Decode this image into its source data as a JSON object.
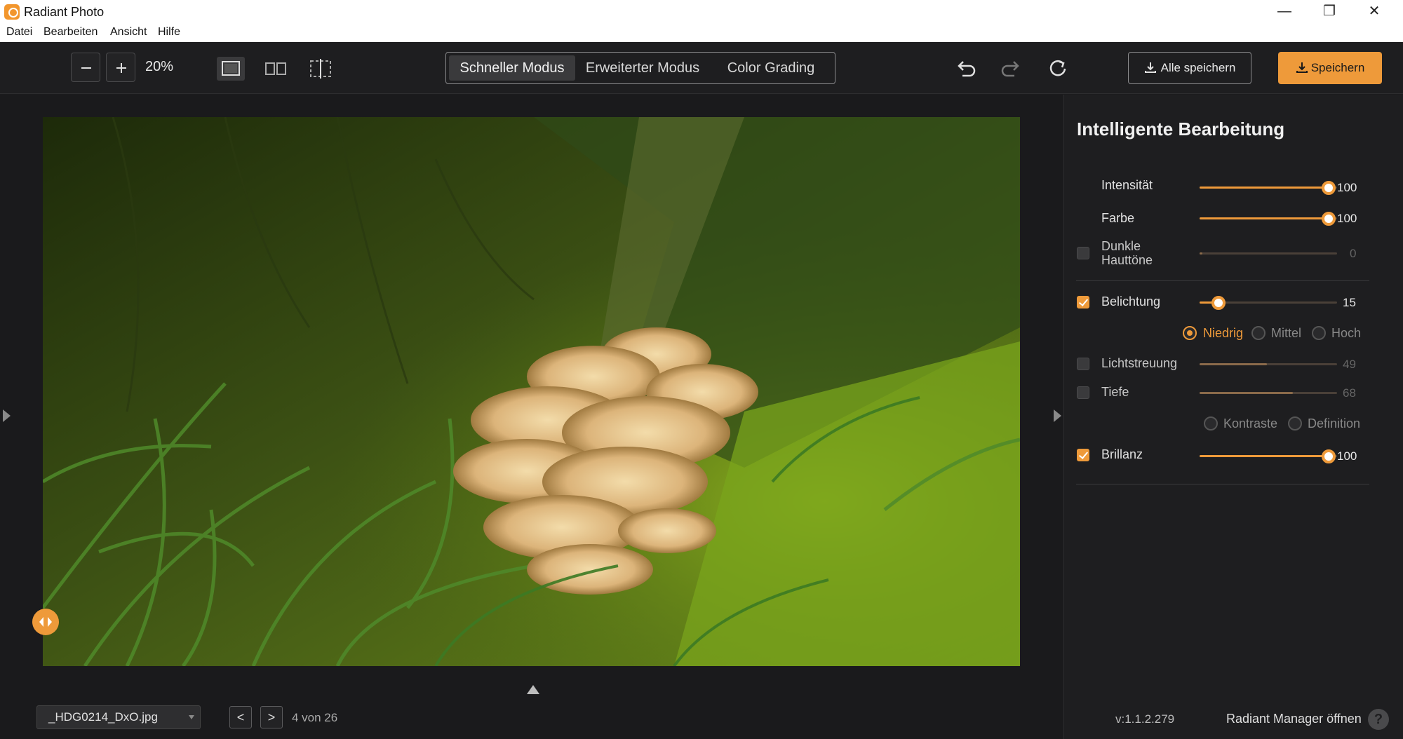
{
  "window": {
    "title": "Radiant Photo",
    "minimize_icon": "—",
    "maximize_icon": "❐",
    "close_icon": "✕"
  },
  "menu": [
    "Datei",
    "Bearbeiten",
    "Ansicht",
    "Hilfe"
  ],
  "toolbar": {
    "zoom_out_icon": "minus-icon",
    "zoom_in_icon": "plus-icon",
    "zoom_level": "20%",
    "modes": [
      "Schneller Modus",
      "Erweiterter Modus",
      "Color Grading"
    ],
    "active_mode": "Schneller Modus",
    "save_all_label": "Alle speichern",
    "save_label": "Speichern",
    "accent_color": "#ee9a3a"
  },
  "panel": {
    "title": "Intelligente Bearbeitung",
    "adjustments": [
      {
        "label": "Intensität",
        "value": "100",
        "fraction": 0.94,
        "checkbox": null
      },
      {
        "label": "Farbe",
        "value": "100",
        "fraction": 0.94,
        "checkbox": null
      },
      {
        "label": "Dunkle Hauttöne",
        "value": "0",
        "fraction": 0.0,
        "checkbox": false
      },
      {
        "label": "Belichtung",
        "value": "15",
        "fraction": 0.14,
        "checkbox": true
      },
      {
        "label": "Lichtstreuung",
        "value": "49",
        "fraction": 0.49,
        "checkbox": false
      },
      {
        "label": "Tiefe",
        "value": "68",
        "fraction": 0.68,
        "checkbox": false
      },
      {
        "label": "Brillanz",
        "value": "100",
        "fraction": 0.94,
        "checkbox": true
      }
    ],
    "exposure_options": [
      "Niedrig",
      "Mittel",
      "Hoch"
    ],
    "exposure_selected": "Niedrig",
    "depth_options": [
      "Kontraste",
      "Definition"
    ],
    "version": "v:1.1.2.279",
    "manager_link": "Radiant Manager öffnen",
    "help_icon": "?"
  },
  "footer": {
    "file_name": "_HDG0214_DxO.jpg",
    "prev_icon": "<",
    "next_icon": ">",
    "page_count": "4 von 26"
  }
}
